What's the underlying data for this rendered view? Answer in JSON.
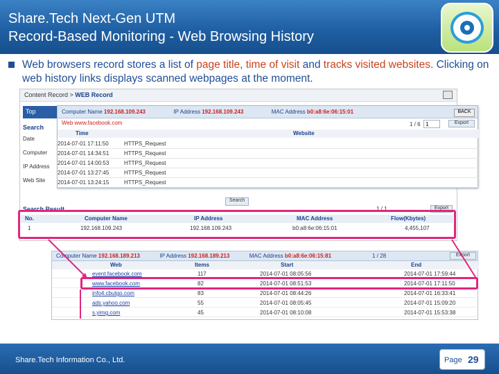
{
  "header": {
    "title_line1": "Share.Tech Next-Gen UTM",
    "title_line2": "Record-Based Monitoring - Web Browsing History",
    "logo_icon": "eye-icon"
  },
  "bullet": {
    "part1": "Web browsers record stores a list of ",
    "hl1": "page title",
    "part2": ", ",
    "hl2": "time of visit",
    "part3": " and ",
    "hl3": "tracks visited websites",
    "part4": ". Clicking on web history links displays scanned webpages at the moment."
  },
  "panel": {
    "crumb_prefix": "Content Record > ",
    "crumb_current": "WEB Record",
    "tab_label": "Top",
    "search_label": "Search",
    "side_labels": [
      "Date",
      "Computer",
      "IP Address",
      "Web Site"
    ],
    "search_button": "Search",
    "search_result_label": "Search Result",
    "result_pager": "1 / 1",
    "export_button": "Export"
  },
  "popup": {
    "computer_name_label": "Computer Name",
    "computer_name_value": "192.168.109.243",
    "ip_label": "IP Address",
    "ip_value": "192.168.109.243",
    "mac_label": "MAC Address",
    "mac_value": "b0:a8:6e:06:15:01",
    "back_button": "BACK",
    "site_link": "Web www.facebook.com",
    "pager": "1 / 6",
    "page_input": "1",
    "export_button": "Export",
    "columns": [
      "Time",
      "Website"
    ],
    "rows": [
      {
        "time": "2014-07-01 17:11:50",
        "site": "HTTPS_Request"
      },
      {
        "time": "2014-07-01 14:34:51",
        "site": "HTTPS_Request"
      },
      {
        "time": "2014-07-01 14:00:53",
        "site": "HTTPS_Request"
      },
      {
        "time": "2014-07-01 13:27:45",
        "site": "HTTPS_Request"
      },
      {
        "time": "2014-07-01 13:24:15",
        "site": "HTTPS_Request"
      }
    ]
  },
  "result": {
    "columns": [
      "No.",
      "Computer Name",
      "IP Address",
      "MAC Address",
      "Flow(Kbytes)"
    ],
    "row": {
      "no": "1",
      "computer": "192.168.109.243",
      "ip": "192.168.109.243",
      "mac": "b0:a8:6e:06:15:01",
      "flow": "4,455,107"
    }
  },
  "lower": {
    "computer_name_label": "Computer Name",
    "computer_name_value": "192.168.189.213",
    "ip_label": "IP Address",
    "ip_value": "192.168.189.213",
    "mac_label": "MAC Address",
    "mac_value": "b0:a8:6e:06:15:81",
    "pager": "1 / 28",
    "export_button": "Export",
    "columns": [
      "Web",
      "Items",
      "Start",
      "End"
    ],
    "rows": [
      {
        "web": "event.facebook.com",
        "items": "117",
        "start": "2014-07-01 08:05:56",
        "end": "2014-07-01 17:59:44"
      },
      {
        "web": "www.facebook.com",
        "items": "82",
        "start": "2014-07-01 08:51:53",
        "end": "2014-07-01 17:11:50"
      },
      {
        "web": "info4.cbutgo.com",
        "items": "83",
        "start": "2014-07-01 08:44:26",
        "end": "2014-07-01 16:33:41"
      },
      {
        "web": "ads.yahoo.com",
        "items": "55",
        "start": "2014-07-01 08:05:45",
        "end": "2014-07-01 15:09:20"
      },
      {
        "web": "s.yimg.com",
        "items": "45",
        "start": "2014-07-01 08:10:08",
        "end": "2014-07-01 15:53:38"
      }
    ]
  },
  "footer": {
    "company": "Share.Tech Information Co., Ltd.",
    "page_label": "Page",
    "page_number": "29"
  },
  "colors": {
    "header_blue": "#1f5fa3",
    "highlight_orange": "#c9421c",
    "annotation_pink": "#e0267e",
    "value_red": "#cc1f1f"
  }
}
